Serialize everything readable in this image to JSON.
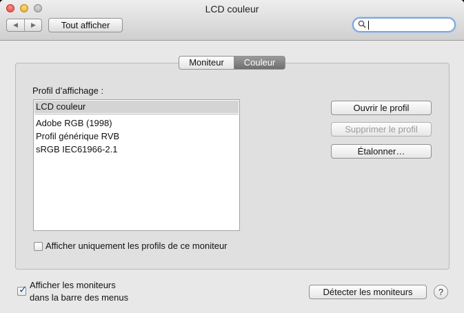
{
  "window": {
    "title": "LCD couleur"
  },
  "toolbar": {
    "back_glyph": "◀",
    "forward_glyph": "▶",
    "show_all_label": "Tout afficher",
    "search_value": "",
    "search_icon_glyph": "🔍"
  },
  "tabs": [
    {
      "label": "Moniteur",
      "selected": false
    },
    {
      "label": "Couleur",
      "selected": true
    }
  ],
  "profile": {
    "heading": "Profil d’affichage :",
    "items": [
      {
        "label": "LCD couleur",
        "selected": true
      },
      {
        "label": "Adobe RGB (1998)",
        "selected": false
      },
      {
        "label": "Profil générique RVB",
        "selected": false
      },
      {
        "label": "sRGB IEC61966-2.1",
        "selected": false
      }
    ],
    "buttons": {
      "open": "Ouvrir le profil",
      "delete": "Supprimer le profil",
      "calibrate": "Étalonner…"
    },
    "only_this_monitor_label": "Afficher uniquement les profils de ce moniteur",
    "only_this_monitor_checked": false
  },
  "footer": {
    "menubar_label_line1": "Afficher les moniteurs",
    "menubar_label_line2": "dans la barre des menus",
    "menubar_checked": true,
    "detect_label": "Détecter les moniteurs",
    "help_glyph": "?"
  },
  "colors": {
    "selected_tab": "#7f7f7f",
    "focus_ring": "#7aa7df",
    "list_selection": "#d4d4d4"
  }
}
